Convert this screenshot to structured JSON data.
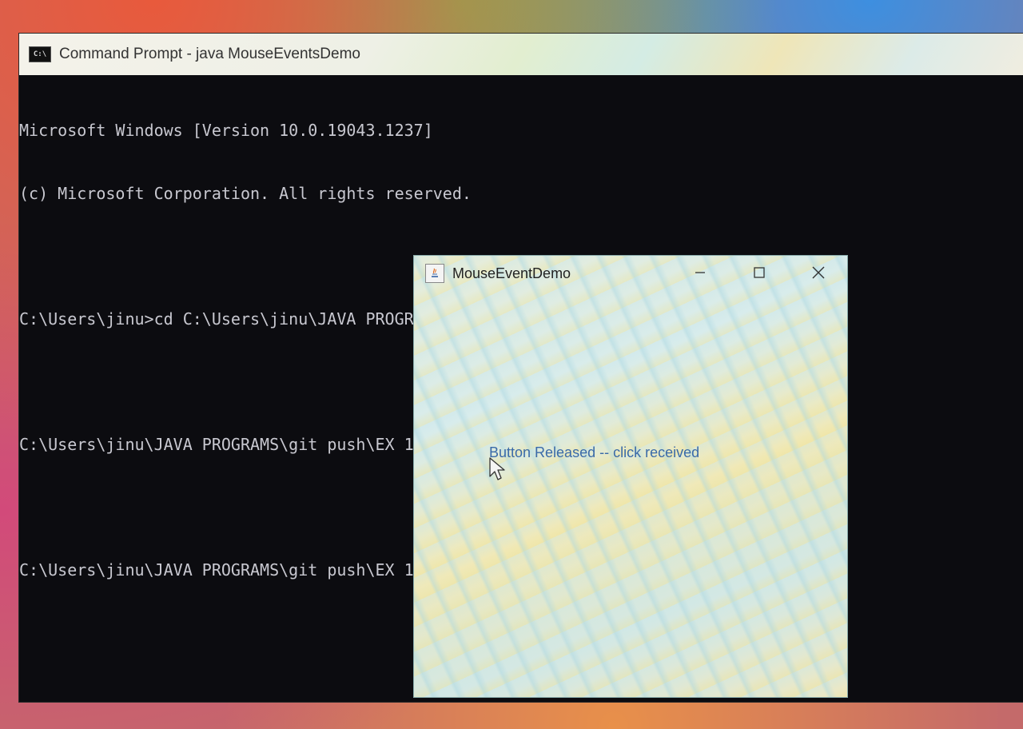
{
  "cmd_window": {
    "title": "Command Prompt - java  MouseEventsDemo",
    "icon": "cmd-icon",
    "icon_label": "C:\\",
    "lines": [
      "Microsoft Windows [Version 10.0.19043.1237]",
      "(c) Microsoft Corporation. All rights reserved.",
      "",
      "C:\\Users\\jinu>cd C:\\Users\\jinu\\JAVA PROGRAMS\\git push\\EX 10\\MouseEvents",
      "",
      "C:\\Users\\jinu\\JAVA PROGRAMS\\git push\\EX 10\\MouseEvents>javac MouseEventsDemo.java",
      "",
      "C:\\Users\\jinu\\JAVA PROGRAMS\\git push\\EX 10\\MouseEvents>java MouseEventsDemo"
    ]
  },
  "java_window": {
    "title": "MouseEventDemo",
    "icon": "java-icon",
    "minimize_icon": "minimize-icon",
    "maximize_icon": "maximize-icon",
    "close_icon": "close-icon",
    "message": "Button Released -- click received"
  }
}
